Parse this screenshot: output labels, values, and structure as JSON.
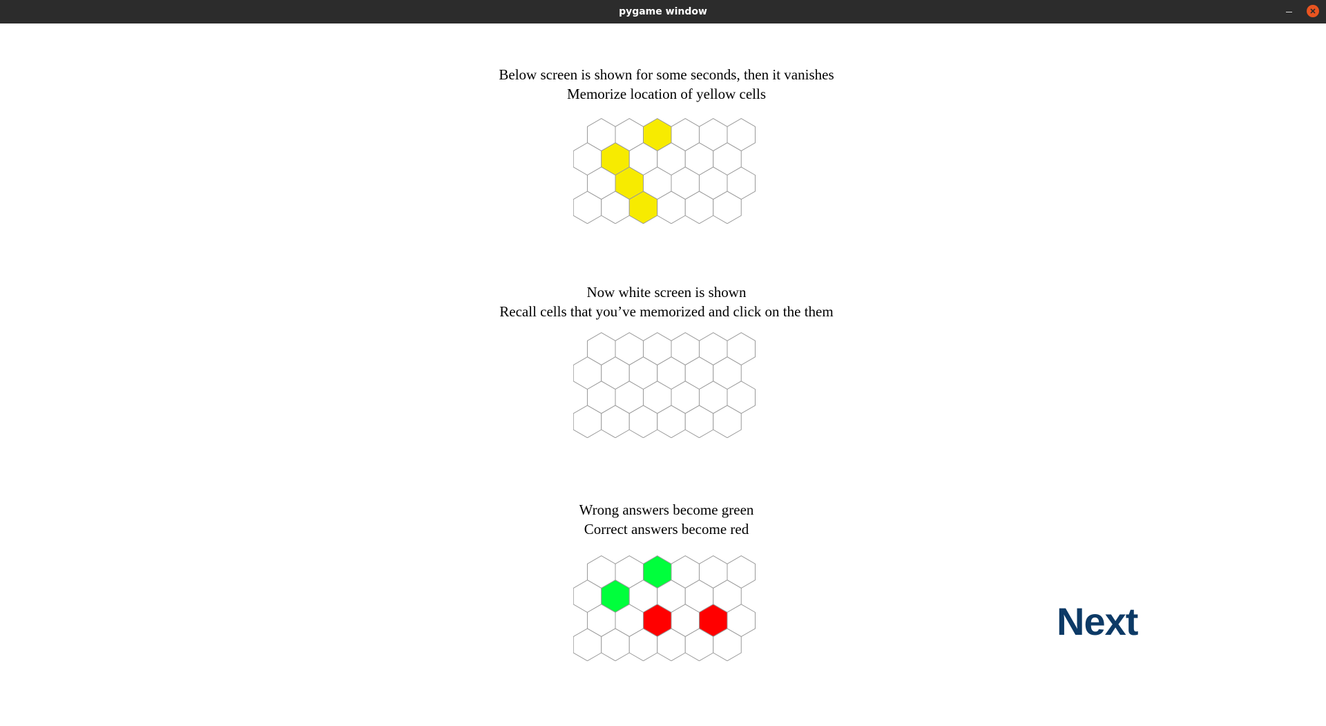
{
  "window": {
    "title": "pygame window",
    "controls": [
      "minimize-icon",
      "close-icon"
    ],
    "close_color": "#e95420"
  },
  "panels": [
    {
      "lines": [
        "Below screen is shown for some seconds, then it vanishes",
        "Memorize location of yellow cells"
      ],
      "highlighted_cells": [
        {
          "row": 0,
          "col": 2,
          "color": "#f7eb00"
        },
        {
          "row": 1,
          "col": 1,
          "color": "#f7eb00"
        },
        {
          "row": 2,
          "col": 1,
          "color": "#f7eb00"
        },
        {
          "row": 3,
          "col": 2,
          "color": "#f7eb00"
        }
      ]
    },
    {
      "lines": [
        "Now white screen is shown",
        "Recall cells that you’ve memorized and click on the them"
      ],
      "highlighted_cells": []
    },
    {
      "lines": [
        "Wrong answers become green",
        "Correct answers become red"
      ],
      "highlighted_cells": [
        {
          "row": 0,
          "col": 2,
          "color": "#00ff3c"
        },
        {
          "row": 1,
          "col": 1,
          "color": "#00ff3c"
        },
        {
          "row": 2,
          "col": 2,
          "color": "#ff0000"
        },
        {
          "row": 2,
          "col": 4,
          "color": "#ff0000"
        }
      ]
    }
  ],
  "grid": {
    "rows": 4,
    "row_cell_counts": [
      6,
      6,
      6,
      6
    ],
    "cell_fill": "#ffffff",
    "cell_stroke": "#9a9a9a"
  },
  "next_button": {
    "label": "Next",
    "color": "#0d3a66"
  }
}
